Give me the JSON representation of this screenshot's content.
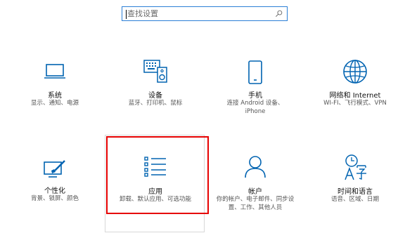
{
  "search": {
    "placeholder": "查找设置"
  },
  "tiles": [
    {
      "title": "系统",
      "desc": "显示、通知、电源"
    },
    {
      "title": "设备",
      "desc": "蓝牙、打印机、鼠标"
    },
    {
      "title": "手机",
      "desc": "连接 Android 设备、iPhone"
    },
    {
      "title": "网络和 Internet",
      "desc": "WI-FI、飞行模式、VPN"
    },
    {
      "title": "个性化",
      "desc": "背景、锁屏、颜色"
    },
    {
      "title": "应用",
      "desc": "卸载、默认应用、可选功能"
    },
    {
      "title": "帐户",
      "desc": "你的帐户、电子邮件、同步设置、工作、其他人员"
    },
    {
      "title": "时间和语言",
      "desc": "语音、区域、日期"
    }
  ],
  "accent": "#0063b1",
  "highlight_color": "#e60000"
}
